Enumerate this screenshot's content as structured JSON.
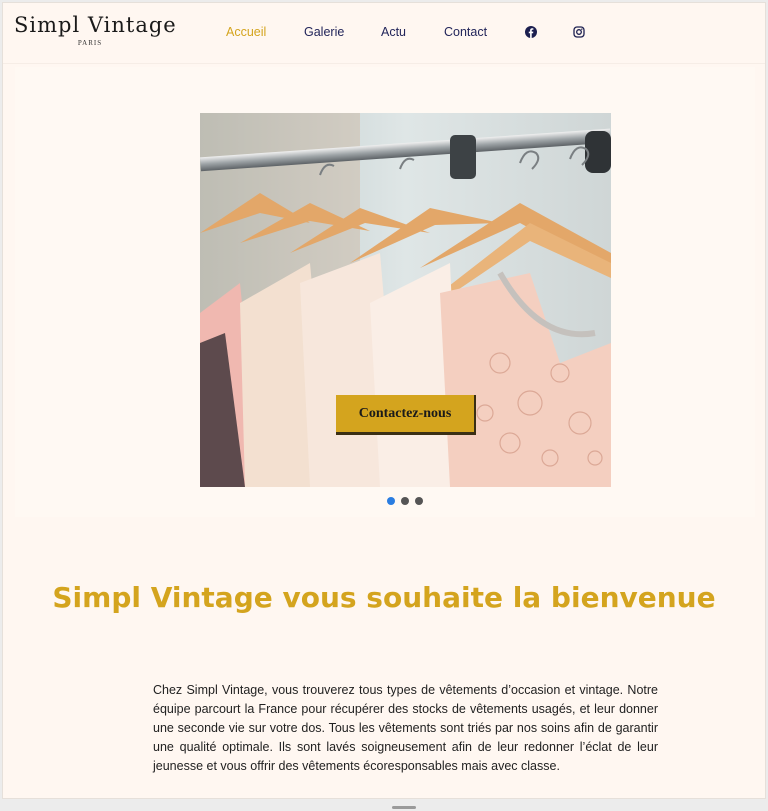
{
  "brand": {
    "name": "Simpl Vintage",
    "subtitle": "PARIS"
  },
  "nav": {
    "items": [
      {
        "label": "Accueil",
        "active": true
      },
      {
        "label": "Galerie",
        "active": false
      },
      {
        "label": "Actu",
        "active": false
      },
      {
        "label": "Contact",
        "active": false
      }
    ],
    "social": [
      "facebook-icon",
      "instagram-icon"
    ]
  },
  "hero": {
    "image": "clothes-on-hangers-photo",
    "cta_label": "Contactez-nous",
    "slides_total": 3,
    "active_slide": 1
  },
  "welcome": {
    "title": "Simpl Vintage vous souhaite la bienvenue",
    "body": "Chez Simpl Vintage, vous trouverez tous types de vêtements d’occasion et vintage. Notre équipe parcourt la France pour récupérer des stocks de vêtements usagés, et leur donner une seconde vie sur votre dos. Tous les vêtements sont triés par nos soins afin de garantir une qualité optimale. Ils sont lavés soigneusement afin de leur redonner l’éclat de leur jeunesse et vous offrir des vêtements écoresponsables mais avec classe."
  },
  "colors": {
    "accent": "#d4a41e",
    "nav_text": "#22255a",
    "background": "#fff7f1",
    "dot_active": "#2a7de1"
  }
}
